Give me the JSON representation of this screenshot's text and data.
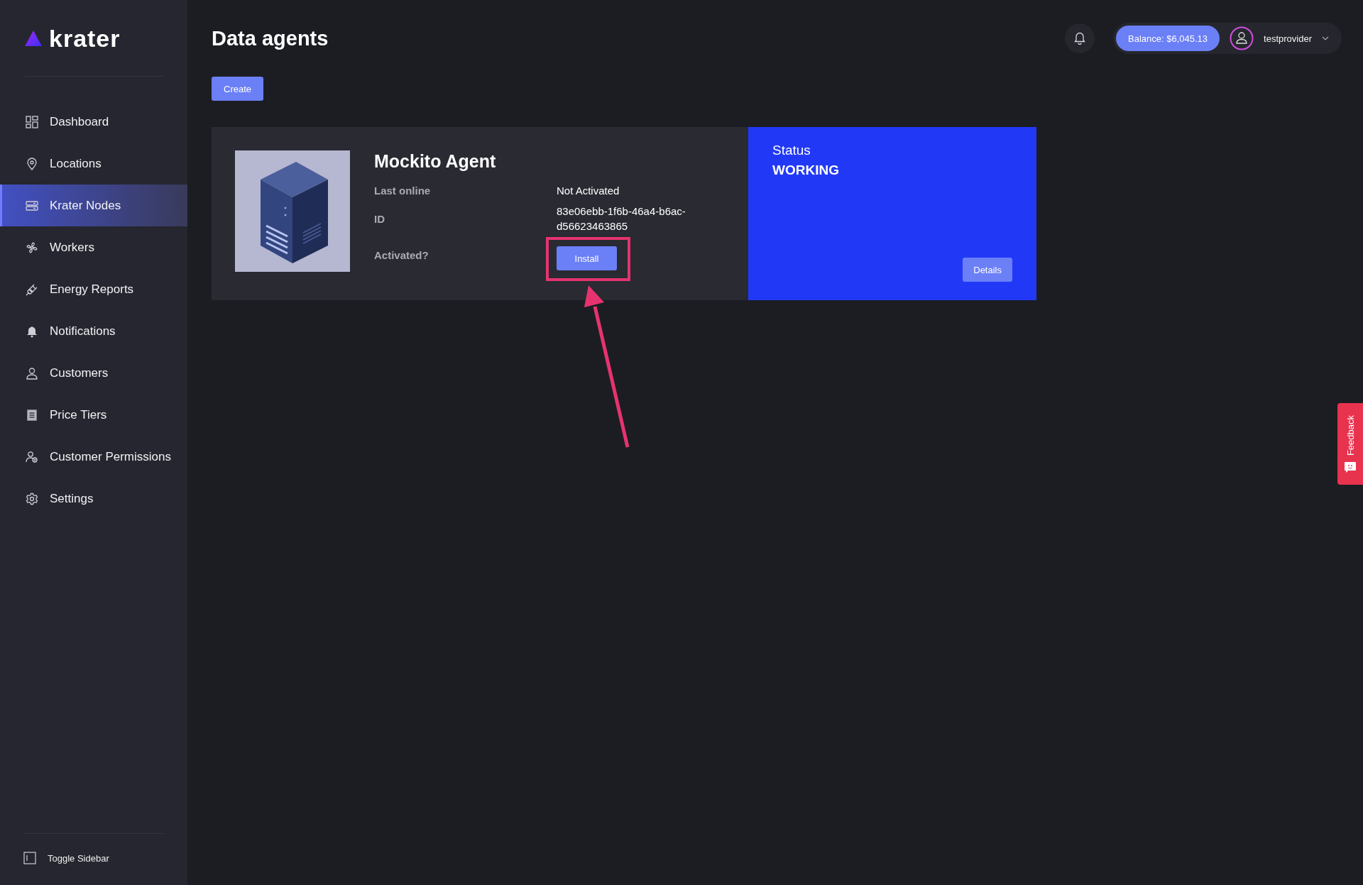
{
  "sidebar": {
    "logo": "krater",
    "items": [
      {
        "label": "Dashboard",
        "selected": false
      },
      {
        "label": "Locations",
        "selected": false
      },
      {
        "label": "Krater Nodes",
        "selected": true
      },
      {
        "label": "Workers",
        "selected": false
      },
      {
        "label": "Energy Reports",
        "selected": false
      },
      {
        "label": "Notifications",
        "selected": false
      },
      {
        "label": "Customers",
        "selected": false
      },
      {
        "label": "Price Tiers",
        "selected": false
      },
      {
        "label": "Customer Permissions",
        "selected": false
      },
      {
        "label": "Settings",
        "selected": false
      }
    ],
    "toggle": "Toggle Sidebar"
  },
  "header": {
    "title": "Data agents",
    "balance": "Balance: $6,045.13",
    "user": "testprovider"
  },
  "create_button": "Create",
  "agent": {
    "name": "Mockito Agent",
    "fields": [
      {
        "label": "Last online",
        "value": "Not Activated"
      },
      {
        "label": "ID",
        "value": "83e06ebb-1f6b-46a4-b6ac-d56623463865"
      }
    ],
    "activated_label": "Activated?",
    "install_button": "Install",
    "status_label": "Status",
    "status": "WORKING",
    "details_button": "Details"
  },
  "feedback": "Feedback"
}
